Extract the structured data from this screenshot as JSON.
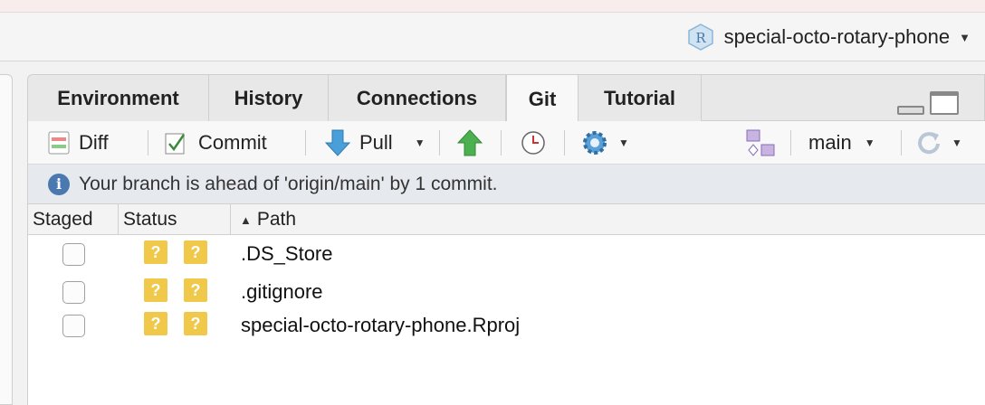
{
  "project": {
    "name": "special-octo-rotary-phone",
    "icon": "rproj-icon"
  },
  "tabs": [
    {
      "label": "Environment",
      "active": false
    },
    {
      "label": "History",
      "active": false
    },
    {
      "label": "Connections",
      "active": false
    },
    {
      "label": "Git",
      "active": true
    },
    {
      "label": "Tutorial",
      "active": false
    }
  ],
  "toolbar": {
    "diff_label": "Diff",
    "commit_label": "Commit",
    "pull_label": "Pull",
    "branch_label": "main"
  },
  "info": {
    "message": "Your branch is ahead of 'origin/main' by 1 commit."
  },
  "table": {
    "columns": {
      "staged": "Staged",
      "status": "Status",
      "path": "Path"
    },
    "rows": [
      {
        "staged": false,
        "status": [
          "?",
          "?"
        ],
        "path": ".DS_Store"
      },
      {
        "staged": false,
        "status": [
          "?",
          "?"
        ],
        "path": ".gitignore"
      },
      {
        "staged": false,
        "status": [
          "?",
          "?"
        ],
        "path": "special-octo-rotary-phone.Rproj"
      }
    ]
  },
  "colors": {
    "status_untracked": "#f0c84a",
    "info_icon": "#4a78b0",
    "pull_arrow": "#4a9fd8",
    "push_arrow": "#4caf50"
  }
}
